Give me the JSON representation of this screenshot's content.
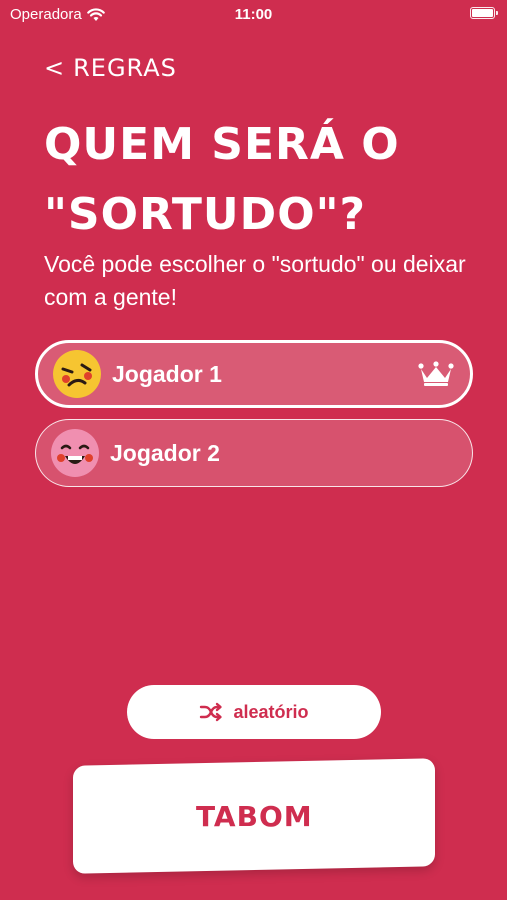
{
  "status_bar": {
    "carrier": "Operadora",
    "time": "11:00"
  },
  "header": {
    "back_label": "REGRAS",
    "back_glyph": "<",
    "title_line1": "QUEM SERÁ O",
    "title_line2": "\"SORTUDO\"?",
    "subtitle": "Você pode escolher o \"sortudo\" ou deixar com a gente!"
  },
  "players": [
    {
      "name": "Jogador 1",
      "selected": true,
      "avatar": "yellow-face-icon"
    },
    {
      "name": "Jogador 2",
      "selected": false,
      "avatar": "pink-face-icon"
    }
  ],
  "actions": {
    "random_label": "aleatório",
    "confirm_label": "TABOM"
  },
  "colors": {
    "background": "#cf2d4f",
    "accent": "#ffffff",
    "avatar_yellow": "#f6c531",
    "avatar_pink": "#f08fb0"
  }
}
